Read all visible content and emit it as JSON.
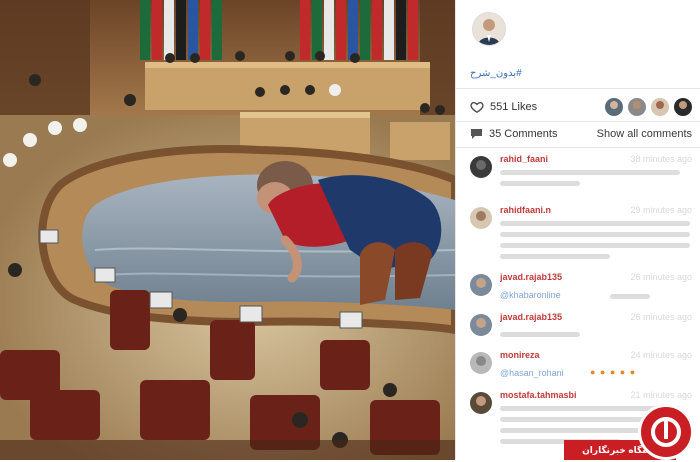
{
  "post": {
    "hashtag": "#بدون_شرح",
    "likes_label": "551 Likes",
    "comments_label": "35 Comments",
    "show_all_label": "Show all comments"
  },
  "comments": [
    {
      "user": "rahid_faani",
      "time": "38 minutes ago"
    },
    {
      "user": "rahidfaani.n",
      "time": "29 minutes ago"
    },
    {
      "user": "javad.rajab135",
      "time": "26 minutes ago",
      "mention": "@khabaronline"
    },
    {
      "user": "javad.rajab135",
      "time": "26 minutes ago"
    },
    {
      "user": "monireza",
      "time": "24 minutes ago",
      "mention": "@hasan_rohani"
    },
    {
      "user": "mostafa.tahmasbi",
      "time": "21 minutes ago"
    }
  ],
  "watermark": {
    "text": "باشگاه خبرنگاران"
  },
  "icons": {
    "like": "heart-icon",
    "comment": "comment-bubble-icon"
  }
}
